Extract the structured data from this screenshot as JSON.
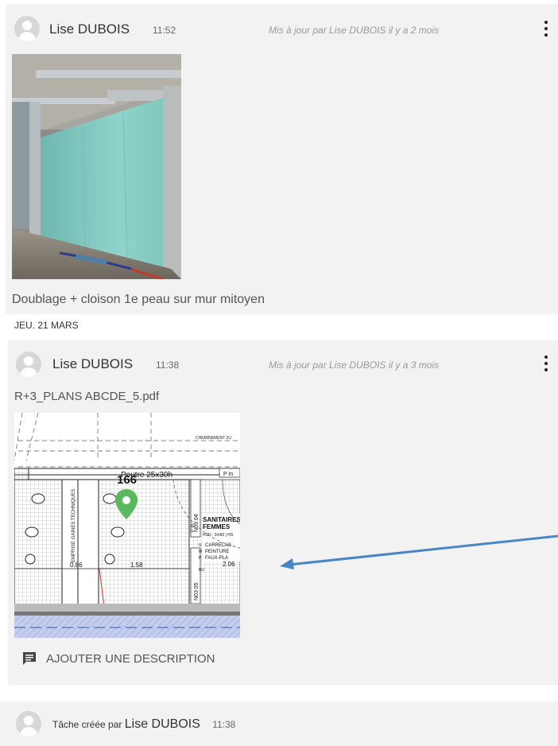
{
  "post1": {
    "author": "Lise DUBOIS",
    "time": "11:52",
    "updated": "Mis à jour par Lise DUBOIS il y a 2 mois",
    "caption": "Doublage + cloison 1e peau sur mur mitoyen"
  },
  "date_separator": "JEU. 21 MARS",
  "post2": {
    "author": "Lise DUBOIS",
    "time": "11:38",
    "updated": "Mis à jour par Lise DUBOIS il y a 3 mois",
    "filename": "R+3_PLANS ABCDE_5.pdf",
    "add_description": "AJOUTER UNE DESCRIPTION",
    "plan": {
      "cheminement": "CHEMINEMENT 2U",
      "poutre": "Poutre 25x30h",
      "marker": "166",
      "p_in": "P In",
      "room1": "N03 04",
      "room2": "N03 05",
      "sanitaires": "SANITAIRES",
      "femmes": "FEMMES",
      "hsd": "HSD : 2m90 | HS",
      "carrelage": "CARRELAG",
      "peinture": "PEINTURE",
      "faux": "FAUX-PLA",
      "dim1": "0.86",
      "dim2": "1.58",
      "dim3": "2.06",
      "gaines": "EMPRISE GAINES TECHNIQUES",
      "s": "S",
      "m": "M",
      "p": "P",
      "bu": "BU"
    }
  },
  "task": {
    "prefix": "Tâche créée par",
    "author": "Lise DUBOIS",
    "time": "11:38"
  },
  "colors": {
    "card_bg": "#f2f2f2",
    "marker_green": "#5cb85c",
    "arrow_blue": "#4a86c5",
    "hatch_blue": "#b8c6e8"
  }
}
